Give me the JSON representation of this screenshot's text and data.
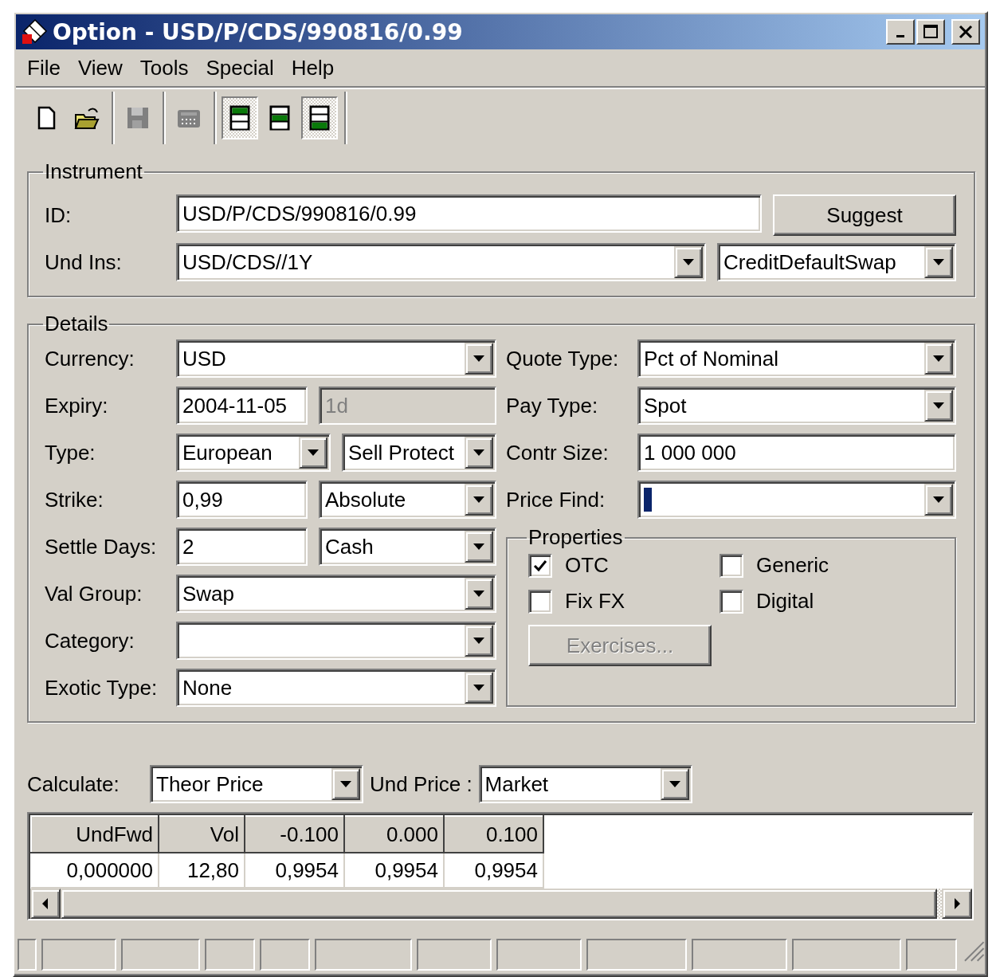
{
  "window": {
    "title": "Option - USD/P/CDS/990816/0.99"
  },
  "menu": [
    "File",
    "View",
    "Tools",
    "Special",
    "Help"
  ],
  "toolbar": {
    "groups": [
      [
        {
          "kind": "new",
          "disabled": false,
          "pressed": false
        },
        {
          "kind": "open",
          "disabled": false,
          "pressed": false
        }
      ],
      [
        {
          "kind": "save",
          "disabled": true,
          "pressed": false
        }
      ],
      [
        {
          "kind": "calculator",
          "disabled": true,
          "pressed": false
        }
      ],
      [
        {
          "kind": "layout-top",
          "disabled": false,
          "pressed": true
        },
        {
          "kind": "layout-middle",
          "disabled": false,
          "pressed": false
        },
        {
          "kind": "layout-bottom",
          "disabled": false,
          "pressed": true
        }
      ]
    ]
  },
  "instrument": {
    "title": "Instrument",
    "rows": [
      {
        "label": "ID:",
        "controls": [
          {
            "kind": "text",
            "value": "USD/P/CDS/990816/0.99",
            "disabled": false
          },
          {
            "kind": "button",
            "value": "Suggest"
          }
        ]
      },
      {
        "label": "Und Ins:",
        "controls": [
          {
            "kind": "combo",
            "value": "USD/CDS//1Y"
          },
          {
            "kind": "combo",
            "value": "CreditDefaultSwap"
          }
        ]
      }
    ]
  },
  "details": {
    "title": "Details",
    "left": [
      {
        "label": "Currency:",
        "controls": [
          {
            "kind": "combo",
            "value": "USD"
          }
        ]
      },
      {
        "label": "Expiry:",
        "controls": [
          {
            "kind": "text",
            "value": "2004-11-05",
            "disabled": false
          },
          {
            "kind": "text",
            "value": "1d",
            "disabled": true
          }
        ]
      },
      {
        "label": "Type:",
        "controls": [
          {
            "kind": "combo",
            "value": "European"
          },
          {
            "kind": "combo",
            "value": "Sell Protect"
          }
        ]
      },
      {
        "label": "Strike:",
        "controls": [
          {
            "kind": "text",
            "value": "0,99",
            "disabled": false
          },
          {
            "kind": "combo",
            "value": "Absolute"
          }
        ]
      },
      {
        "label": "Settle Days:",
        "controls": [
          {
            "kind": "text",
            "value": "2",
            "disabled": false
          },
          {
            "kind": "combo",
            "value": "Cash"
          }
        ]
      },
      {
        "label": "Val Group:",
        "controls": [
          {
            "kind": "combo",
            "value": "Swap"
          }
        ]
      },
      {
        "label": "Category:",
        "controls": [
          {
            "kind": "combo"
          }
        ]
      },
      {
        "label": "Exotic Type:",
        "controls": [
          {
            "kind": "combo",
            "value": "None"
          }
        ]
      }
    ],
    "right": [
      {
        "label": "Quote Type:",
        "controls": [
          {
            "kind": "combo",
            "value": "Pct of Nominal"
          }
        ]
      },
      {
        "label": "Pay Type:",
        "controls": [
          {
            "kind": "combo",
            "value": "Spot"
          }
        ]
      },
      {
        "label": "Contr Size:",
        "controls": [
          {
            "kind": "text",
            "value": "1 000 000",
            "disabled": false
          }
        ]
      },
      {
        "label": "Price Find:",
        "controls": [
          {
            "kind": "combo",
            "focused": true
          }
        ]
      }
    ],
    "properties": {
      "title": "Properties",
      "options": [
        {
          "label": "OTC",
          "checked": true
        },
        {
          "label": "Generic",
          "checked": false
        },
        {
          "label": "Fix FX",
          "checked": false
        },
        {
          "label": "Digital",
          "checked": false
        }
      ],
      "button": {
        "label": "Exercises...",
        "disabled": true
      }
    }
  },
  "calculate": {
    "label": "Calculate:",
    "value": "Theor Price"
  },
  "und_price": {
    "label": "Und Price :",
    "value": "Market"
  },
  "grid": {
    "columns": [
      "UndFwd",
      "Vol",
      "-0.100",
      "0.000",
      "0.100"
    ],
    "rows": [
      [
        "0,000000",
        "12,80",
        "0,9954",
        "0,9954",
        "0,9954"
      ]
    ]
  }
}
